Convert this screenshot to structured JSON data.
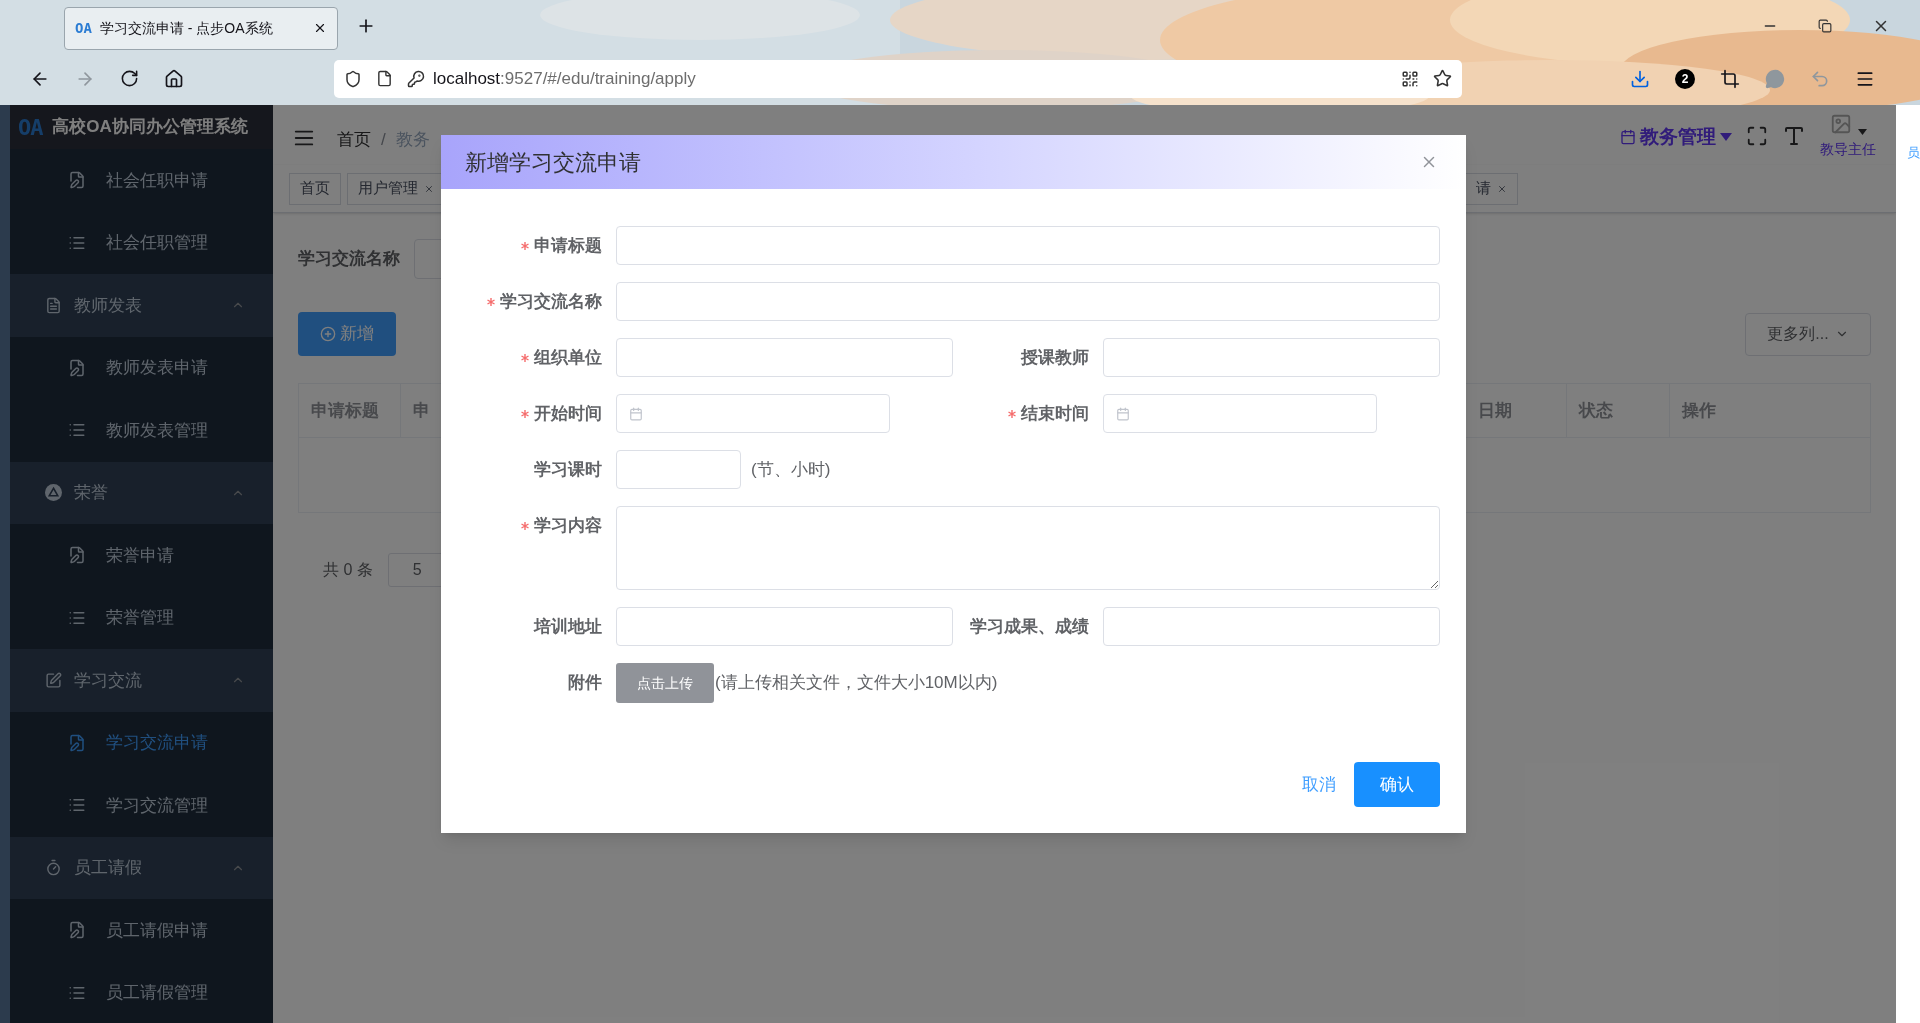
{
  "browser": {
    "tab_logo": "OA",
    "tab_title": "学习交流申请 - 点步OA系统",
    "url_host": "localhost",
    "url_rest": ":9527/#/edu/training/apply",
    "forward_enabled": false,
    "download_badge": "2"
  },
  "sidebar": {
    "logo": "OA",
    "title": "高校OA协同办公管理系统",
    "items": [
      {
        "label": "社会任职申请",
        "kind": "apply",
        "selected": false
      },
      {
        "label": "社会任职管理",
        "kind": "manage",
        "selected": false
      },
      {
        "label": "教师发表",
        "kind": "group",
        "expanded": true
      },
      {
        "label": "教师发表申请",
        "kind": "apply",
        "selected": false
      },
      {
        "label": "教师发表管理",
        "kind": "manage",
        "selected": false
      },
      {
        "label": "荣誉",
        "kind": "group",
        "expanded": true
      },
      {
        "label": "荣誉申请",
        "kind": "apply",
        "selected": false
      },
      {
        "label": "荣誉管理",
        "kind": "manage",
        "selected": false
      },
      {
        "label": "学习交流",
        "kind": "group",
        "expanded": true
      },
      {
        "label": "学习交流申请",
        "kind": "apply",
        "selected": true
      },
      {
        "label": "学习交流管理",
        "kind": "manage",
        "selected": false
      },
      {
        "label": "员工请假",
        "kind": "group",
        "expanded": true
      },
      {
        "label": "员工请假申请",
        "kind": "apply",
        "selected": false
      },
      {
        "label": "员工请假管理",
        "kind": "manage",
        "selected": false
      }
    ]
  },
  "header": {
    "breadcrumb": [
      "首页",
      "教务"
    ],
    "breadcrumb_separator": "/",
    "role_menu": "教务管理",
    "user_role": "教导主任"
  },
  "tags": [
    {
      "label": "首页",
      "closable": false
    },
    {
      "label": "用户管理",
      "closable": true
    },
    {
      "label": "请",
      "closable": true
    }
  ],
  "search": {
    "label": "学习交流名称"
  },
  "add_button": "新增",
  "more_columns_button": "更多列...",
  "table": {
    "columns_left": [
      "申请标题",
      "申"
    ],
    "columns_right": [
      "日期",
      "状态",
      "操作"
    ]
  },
  "pagination": {
    "total": "共 0 条",
    "page_size": "5"
  },
  "right_edge_text": "员",
  "dialog": {
    "title": "新增学习交流申请",
    "rows": [
      {
        "fields": [
          {
            "label": "申请标题",
            "required": true,
            "kind": "text"
          }
        ]
      },
      {
        "fields": [
          {
            "label": "学习交流名称",
            "required": true,
            "kind": "text"
          }
        ]
      },
      {
        "fields": [
          {
            "label": "组织单位",
            "required": true,
            "kind": "text"
          },
          {
            "label": "授课教师",
            "required": false,
            "kind": "text"
          }
        ]
      },
      {
        "fields": [
          {
            "label": "开始时间",
            "required": true,
            "kind": "date"
          },
          {
            "label": "结束时间",
            "required": true,
            "kind": "date"
          }
        ]
      },
      {
        "fields": [
          {
            "label": "学习课时",
            "required": false,
            "kind": "short",
            "suffix": "(节、小时)"
          }
        ]
      },
      {
        "fields": [
          {
            "label": "学习内容",
            "required": true,
            "kind": "textarea"
          }
        ]
      },
      {
        "fields": [
          {
            "label": "培训地址",
            "required": false,
            "kind": "text"
          },
          {
            "label": "学习成果、成绩",
            "required": false,
            "kind": "text"
          }
        ]
      },
      {
        "fields": [
          {
            "label": "附件",
            "required": false,
            "kind": "upload",
            "button": "点击上传",
            "hint": "(请上传相关文件，文件大小10M以内)"
          }
        ]
      }
    ],
    "cancel": "取消",
    "confirm": "确认"
  }
}
